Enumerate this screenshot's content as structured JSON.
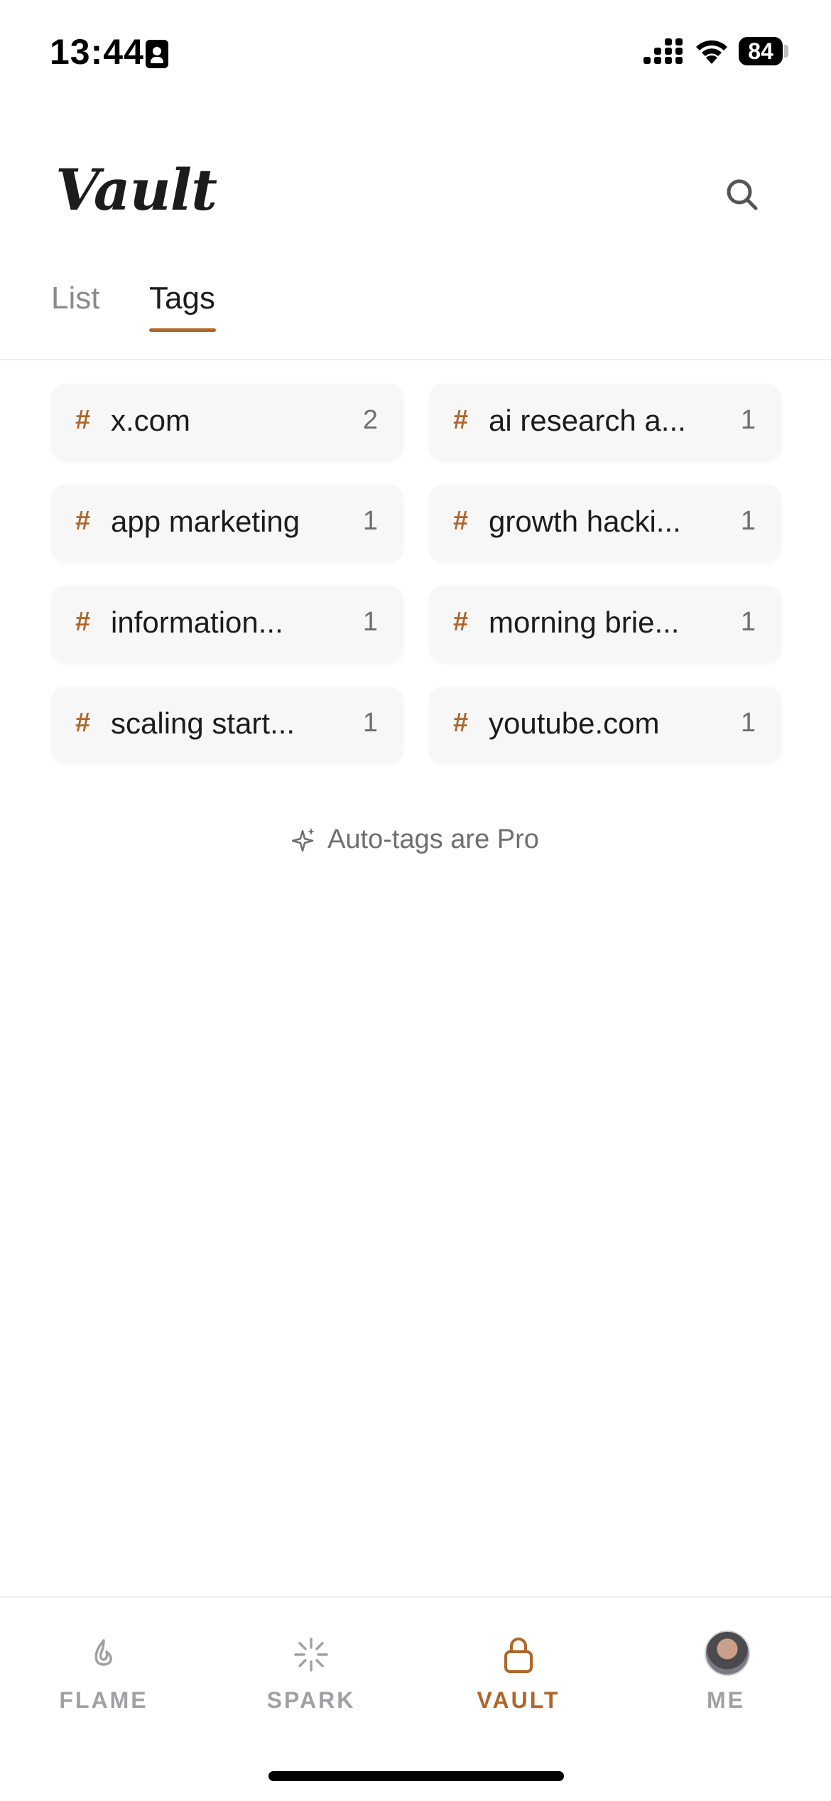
{
  "status_bar": {
    "time": "13:44",
    "battery": "84"
  },
  "header": {
    "title": "Vault"
  },
  "tabs": [
    {
      "label": "List",
      "active": false
    },
    {
      "label": "Tags",
      "active": true
    }
  ],
  "tags": [
    {
      "name": "x.com",
      "count": "2"
    },
    {
      "name": "ai research a...",
      "count": "1"
    },
    {
      "name": "app marketing",
      "count": "1"
    },
    {
      "name": "growth hacki...",
      "count": "1"
    },
    {
      "name": "information...",
      "count": "1"
    },
    {
      "name": "morning brie...",
      "count": "1"
    },
    {
      "name": "scaling start...",
      "count": "1"
    },
    {
      "name": "youtube.com",
      "count": "1"
    }
  ],
  "tag_prefix": "#",
  "pro_notice": "Auto-tags are Pro",
  "nav": [
    {
      "label": "FLAME",
      "icon": "flame-icon",
      "active": false
    },
    {
      "label": "SPARK",
      "icon": "spark-icon",
      "active": false
    },
    {
      "label": "VAULT",
      "icon": "lock-icon",
      "active": true
    },
    {
      "label": "ME",
      "icon": "avatar",
      "active": false
    }
  ],
  "colors": {
    "accent": "#b0652a",
    "muted": "#8a8a8e",
    "card": "#f7f7f7"
  }
}
